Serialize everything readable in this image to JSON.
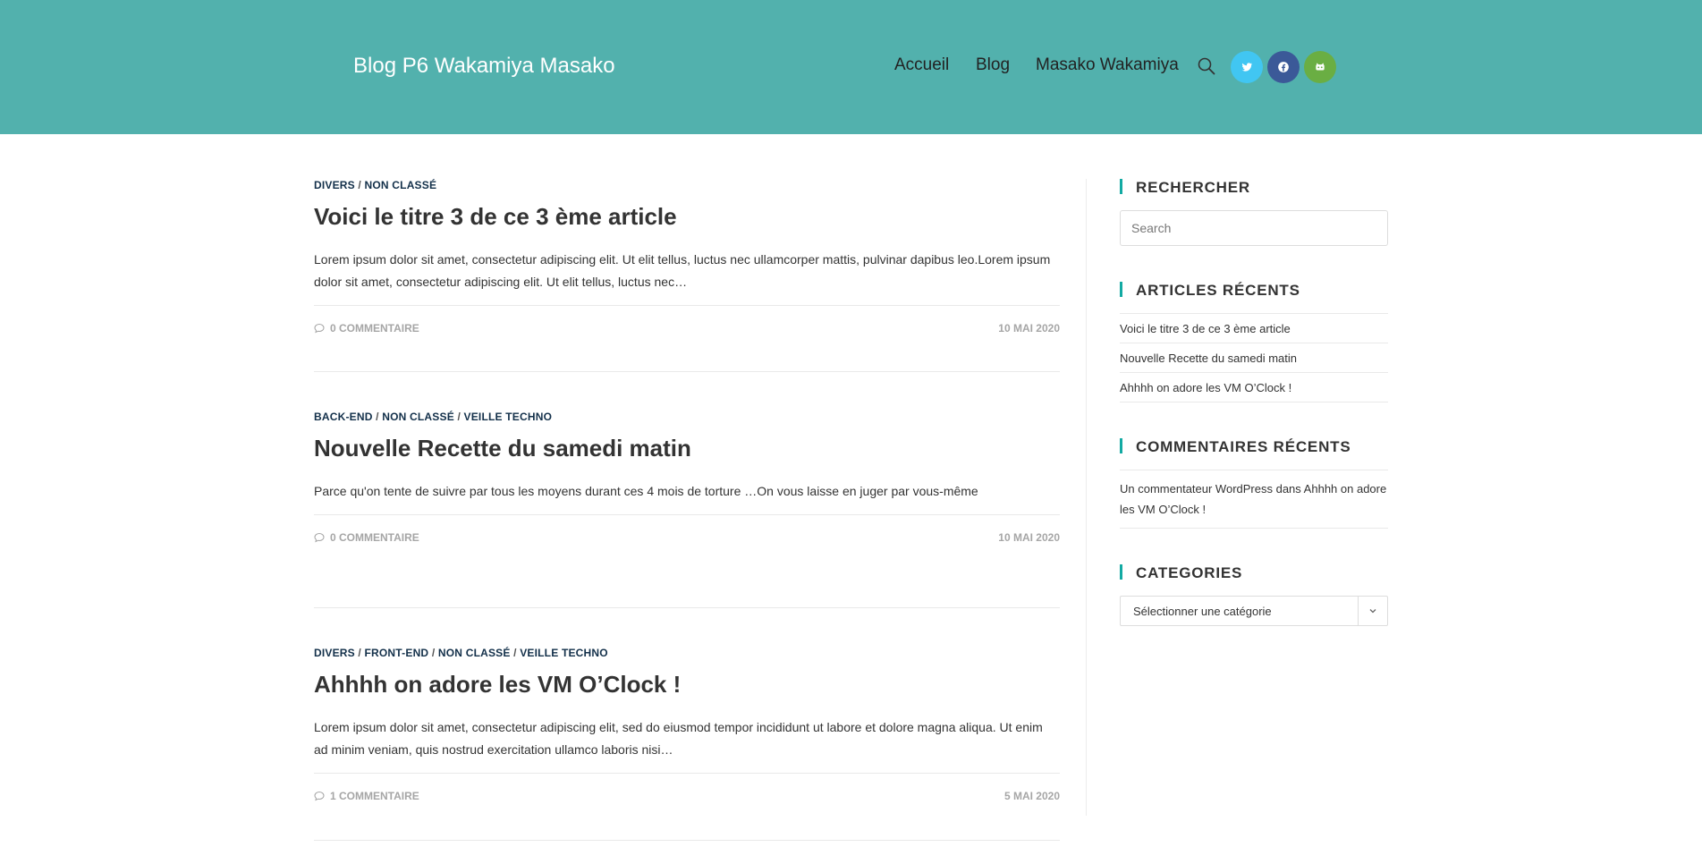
{
  "header": {
    "site_title": "Blog P6 Wakamiya Masako",
    "nav": [
      "Accueil",
      "Blog",
      "Masako Wakamiya"
    ],
    "search_icon": "search-icon",
    "social": [
      {
        "name": "twitter-icon",
        "color": "#41c6f2"
      },
      {
        "name": "facebook-icon",
        "color": "#3b5998"
      },
      {
        "name": "github-icon",
        "color": "#6aae43"
      }
    ],
    "bg_color": "#52b1ad"
  },
  "posts": [
    {
      "categories": [
        "DIVERS",
        "NON CLASSÉ"
      ],
      "title": "Voici le titre 3 de ce 3 ème article",
      "excerpt": "Lorem ipsum dolor sit amet, consectetur adipiscing elit. Ut elit tellus, luctus nec ullamcorper mattis, pulvinar dapibus leo.Lorem ipsum dolor sit amet, consectetur adipiscing elit. Ut elit tellus, luctus nec…",
      "comments": "0 COMMENTAIRE",
      "date": "10 MAI 2020"
    },
    {
      "categories": [
        "BACK-END",
        "NON CLASSÉ",
        "VEILLE TECHNO"
      ],
      "title": "Nouvelle Recette du samedi matin",
      "excerpt": "Parce qu'on tente de suivre par tous les moyens durant ces 4 mois de torture …On vous laisse en juger par vous-même",
      "comments": "0 COMMENTAIRE",
      "date": "10 MAI 2020"
    },
    {
      "categories": [
        "DIVERS",
        "FRONT-END",
        "NON CLASSÉ",
        "VEILLE TECHNO"
      ],
      "title": "Ahhhh on adore les VM O’Clock !",
      "excerpt": "Lorem ipsum dolor sit amet, consectetur adipiscing elit, sed do eiusmod tempor incididunt ut labore et dolore magna aliqua. Ut enim ad minim veniam, quis nostrud exercitation ullamco laboris nisi…",
      "comments": "1 COMMENTAIRE",
      "date": "5 MAI 2020"
    }
  ],
  "sidebar": {
    "search": {
      "title": "RECHERCHER",
      "placeholder": "Search"
    },
    "recent_posts": {
      "title": "ARTICLES RÉCENTS",
      "items": [
        "Voici le titre 3 de ce 3 ème article",
        "Nouvelle Recette du samedi matin",
        "Ahhhh on adore les VM O’Clock !"
      ]
    },
    "recent_comments": {
      "title": "COMMENTAIRES RÉCENTS",
      "text": "Un commentateur WordPress dans Ahhhh on adore les VM O’Clock !"
    },
    "categories": {
      "title": "CATEGORIES",
      "selected": "Sélectionner une catégorie"
    }
  }
}
